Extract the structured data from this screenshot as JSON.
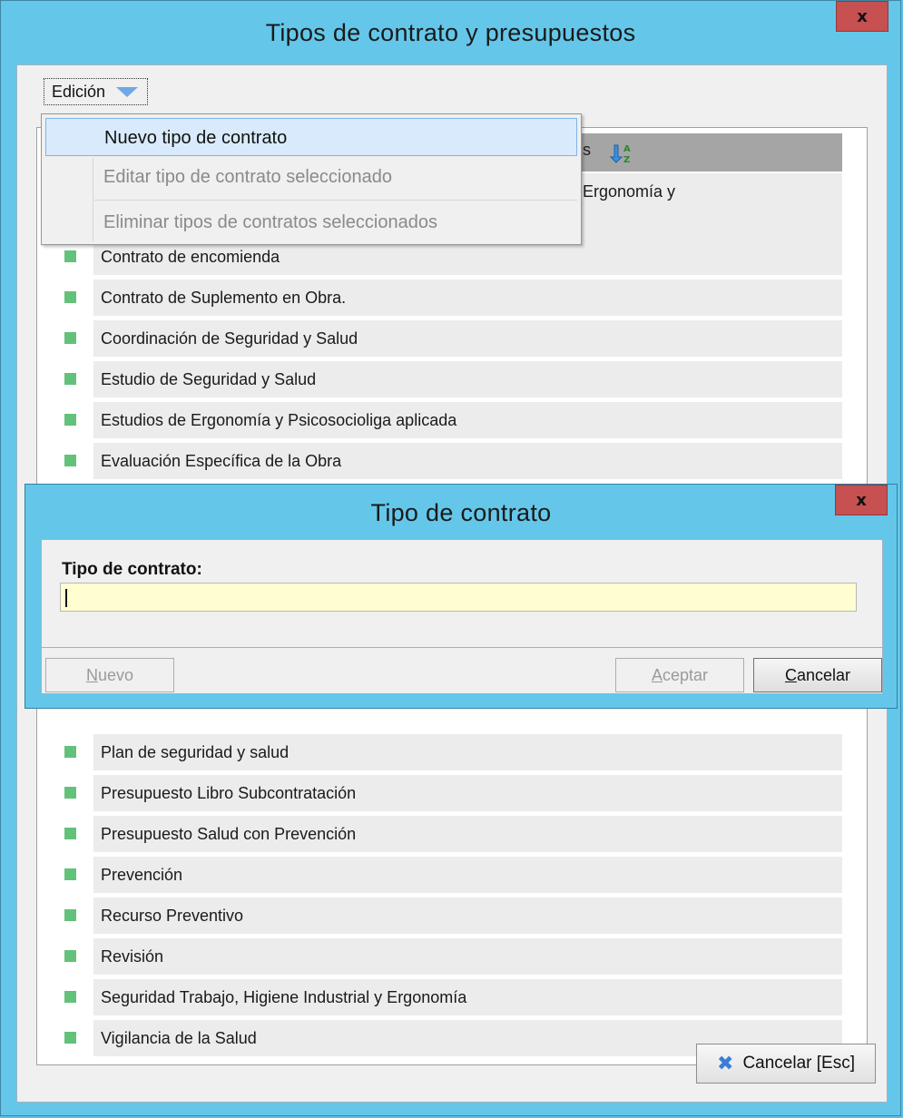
{
  "window": {
    "title": "Tipos de contrato y presupuestos",
    "close_label": "x"
  },
  "menu": {
    "label": "Edición",
    "items": [
      {
        "label": "Nuevo tipo de contrato",
        "state": "highlighted"
      },
      {
        "label": "Editar tipo de contrato seleccionado",
        "state": "disabled"
      },
      {
        "label": "Eliminar tipos de contratos seleccionados",
        "state": "disabled"
      }
    ]
  },
  "grid": {
    "header_fragment": "s",
    "rows_partial": [
      {
        "label": "l, Ergonomía y"
      }
    ],
    "rows_top": [
      {
        "label": "Contrato de encomienda"
      },
      {
        "label": "Contrato de Suplemento en Obra."
      },
      {
        "label": "Coordinación de Seguridad y Salud"
      },
      {
        "label": "Estudio de Seguridad y Salud"
      },
      {
        "label": "Estudios de Ergonomía y Psicosocioliga aplicada"
      },
      {
        "label": "Evaluación Específica de la Obra"
      }
    ],
    "rows_bottom": [
      {
        "label": "Plan de seguridad y salud"
      },
      {
        "label": "Presupuesto Libro Subcontratación"
      },
      {
        "label": "Presupuesto Salud con Prevención"
      },
      {
        "label": "Prevención"
      },
      {
        "label": "Recurso Preventivo"
      },
      {
        "label": "Revisión"
      },
      {
        "label": "Seguridad Trabajo, Higiene Industrial y Ergonomía"
      },
      {
        "label": "Vigilancia de la Salud"
      }
    ]
  },
  "footer": {
    "cancel_label": "Cancelar  [Esc]"
  },
  "dialog": {
    "title": "Tipo de contrato",
    "close_label": "x",
    "field_label": "Tipo de contrato:",
    "field_value": "",
    "buttons": {
      "new_first": "N",
      "new_rest": "uevo",
      "accept_first": "A",
      "accept_rest": "ceptar",
      "cancel_first": "C",
      "cancel_rest": "ancelar"
    }
  },
  "colors": {
    "titlebar": "#64c7ea",
    "close": "#c75050",
    "row_marker": "#63c27a",
    "input_bg": "#fffed0",
    "menu_highlight": "#d9eafc"
  }
}
